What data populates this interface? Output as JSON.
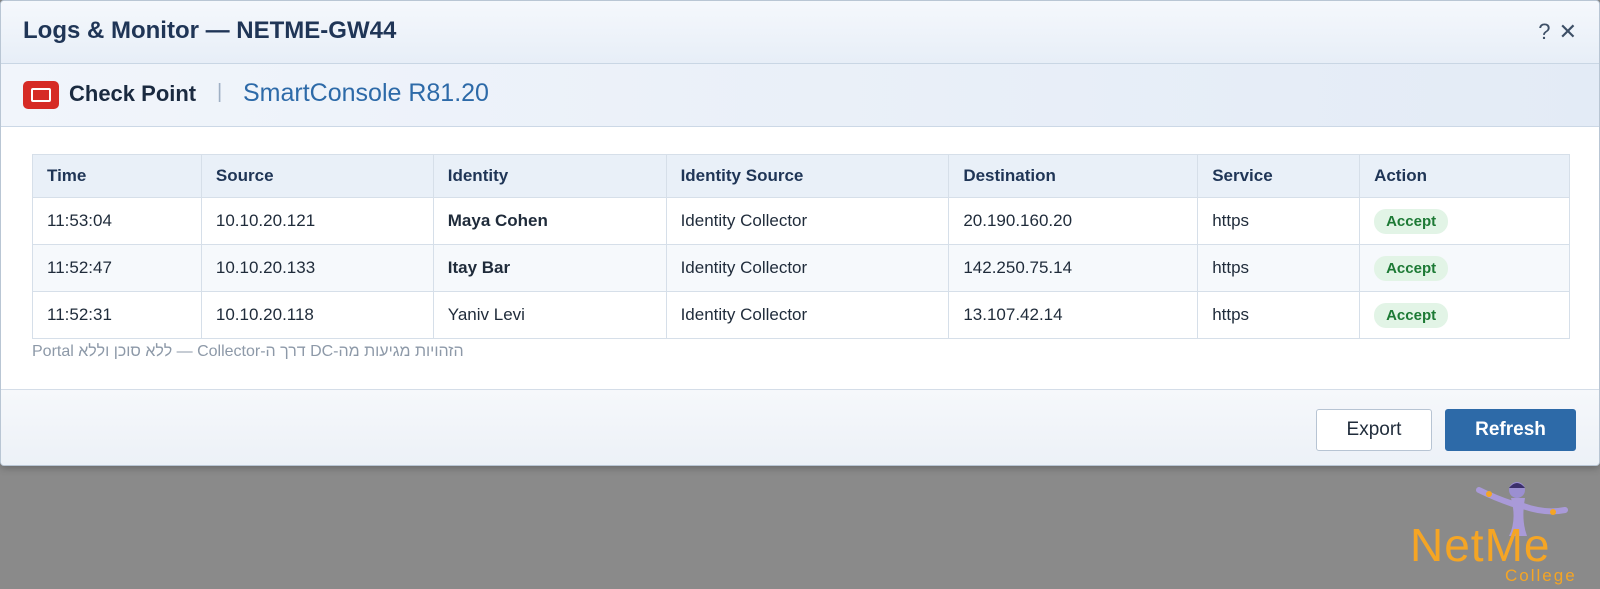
{
  "window": {
    "title": "Logs & Monitor — NETME-GW44",
    "help_label": "?",
    "close_label": "✕"
  },
  "brand": {
    "vendor": "Check Point",
    "separator": "|",
    "product": "SmartConsole R81.20",
    "logo_color": "#d62b25"
  },
  "table": {
    "columns": [
      "Time",
      "Source",
      "Identity",
      "Identity Source",
      "Destination",
      "Service",
      "Action"
    ],
    "rows": [
      {
        "time": "11:53:04",
        "source": "10.10.20.121",
        "identity": "Maya Cohen",
        "identity_source": "Identity Collector",
        "destination": "20.190.160.20",
        "service": "https",
        "action": "Accept"
      },
      {
        "time": "11:52:47",
        "source": "10.10.20.133",
        "identity": "Itay Bar",
        "identity_source": "Identity Collector",
        "destination": "142.250.75.14",
        "service": "https",
        "action": "Accept"
      },
      {
        "time": "11:52:31",
        "source": "10.10.20.118",
        "identity": "Yaniv Levi",
        "identity_source": "Identity Collector",
        "destination": "13.107.42.14",
        "service": "https",
        "action": "Accept"
      }
    ]
  },
  "footnote": "הזהויות מגיעות מה-DC דרך ה-Collector — ללא סוכן וללא Portal",
  "footer": {
    "export_label": "Export",
    "refresh_label": "Refresh"
  },
  "watermark": {
    "text": "NetMe",
    "subtext": "College",
    "color": "#f5a524"
  },
  "colors": {
    "accent": "#2d6aa8",
    "accept_badge_bg": "#e2f4e6",
    "accept_badge_text": "#1d7a35"
  }
}
